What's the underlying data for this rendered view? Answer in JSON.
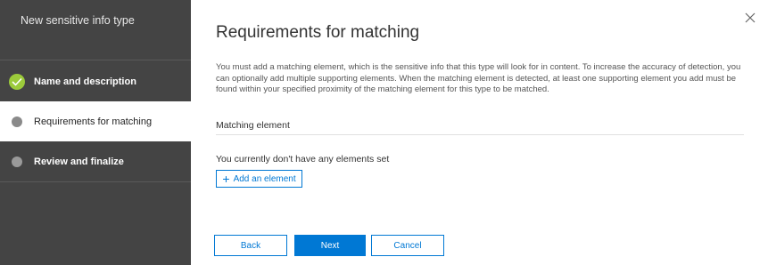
{
  "wizard": {
    "title": "New sensitive info type",
    "steps": [
      {
        "label": "Name and description",
        "state": "completed"
      },
      {
        "label": "Requirements for matching",
        "state": "current"
      },
      {
        "label": "Review and finalize",
        "state": "pending"
      }
    ]
  },
  "main": {
    "title": "Requirements for matching",
    "description": "You must add a matching element, which is the sensitive info that this type will look for in content. To increase the accuracy of detection, you can optionally add multiple supporting elements. When the matching element is detected, at least one supporting element you add must be found within your specified proximity of the matching element for this type to be matched.",
    "section_title": "Matching element",
    "empty_message": "You currently don't have any elements set",
    "add_element_label": "Add an element"
  },
  "footer": {
    "back_label": "Back",
    "next_label": "Next",
    "cancel_label": "Cancel"
  },
  "colors": {
    "sidebar_bg": "#444444",
    "accent": "#0078d4",
    "completed": "#9ccb3b"
  },
  "icons": {
    "close": "close-icon",
    "completed_step": "checkmark-icon",
    "add": "plus-icon"
  }
}
